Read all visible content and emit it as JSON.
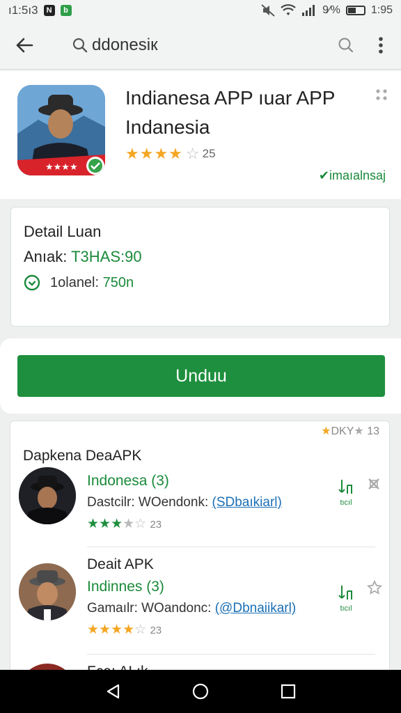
{
  "status": {
    "time_left": "ı1:5ı3",
    "signal_pct": "9⁄%",
    "time_right": "1:95"
  },
  "search": {
    "query": "ddonesiк"
  },
  "app": {
    "title": "Indianesa APP ıuar APP Indanesia",
    "stars": "★★★★",
    "star_empty": "☆",
    "rating": "25",
    "verified": "✔imaıalnsaj"
  },
  "details": {
    "title": "Detail Luan",
    "android_label": "Anıak:",
    "android_value": "T3HAS:90",
    "size_label": "1olanel:",
    "size_value": "750n"
  },
  "download": {
    "label": "Unduu"
  },
  "list": {
    "top_rating": "DKY",
    "top_rating_count": "13",
    "header": "Dapkena DeaAPK",
    "items": [
      {
        "name": "Indonesa (3)",
        "detail_prefix": "Dastcilr: WOendonk:",
        "detail_link": "(SDbaıkiarl)",
        "stars": "★★★",
        "star_empty": "★☆",
        "count": "23",
        "dl_label": "tıcıl"
      },
      {
        "title": "Deait APK",
        "name": "Indinnes (3)",
        "detail_prefix": "Gamaılr: WOandonc:",
        "detail_link": "(@Dbnaiikarl)",
        "stars": "★★★★",
        "star_empty": "☆",
        "count": "23",
        "dl_label": "tıcıl"
      },
      {
        "title": "Fcaı ALık"
      }
    ]
  },
  "colors": {
    "accent_green": "#1e8f3e",
    "star_gold": "#f5a623",
    "link_blue": "#1a6fb5"
  }
}
